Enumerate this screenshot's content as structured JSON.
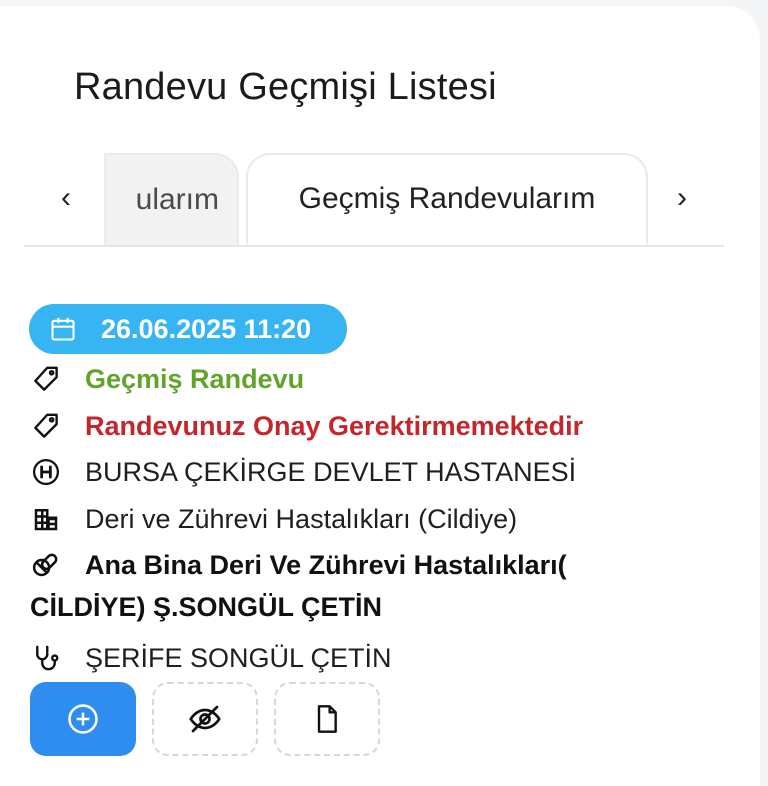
{
  "page": {
    "title": "Randevu Geçmişi Listesi"
  },
  "tabs": {
    "prev_arrow": "‹",
    "next_arrow": "›",
    "items": [
      {
        "label": "ularım",
        "active": false
      },
      {
        "label": "Geçmiş Randevularım",
        "active": true
      }
    ]
  },
  "appointment": {
    "datetime": "26.06.2025 11:20",
    "status": "Geçmiş Randevu",
    "approval": "Randevunuz Onay Gerektirmemektedir",
    "hospital": "BURSA ÇEKİRGE DEVLET HASTANESİ",
    "clinic": "Deri ve Zührevi Hastalıkları (Cildiye)",
    "examination_place_line1": "Ana Bina Deri Ve Zührevi Hastalıkları(",
    "examination_place_line2": "CİLDİYE) Ş.SONGÜL ÇETİN",
    "doctor": "ŞERİFE SONGÜL ÇETİN"
  },
  "colors": {
    "date_pill": "#36b5f2",
    "status_green": "#5ea52a",
    "approval_red": "#c4262b",
    "primary_button": "#2f8df0"
  },
  "icons": {
    "date": "calendar-icon",
    "status": "tag-icon",
    "approval": "tag-icon",
    "hospital": "hospital-h-icon",
    "clinic": "building-icon",
    "place": "pills-icon",
    "doctor": "stethoscope-icon",
    "actions": [
      "plus-circle-icon",
      "eye-off-icon",
      "document-icon"
    ]
  }
}
